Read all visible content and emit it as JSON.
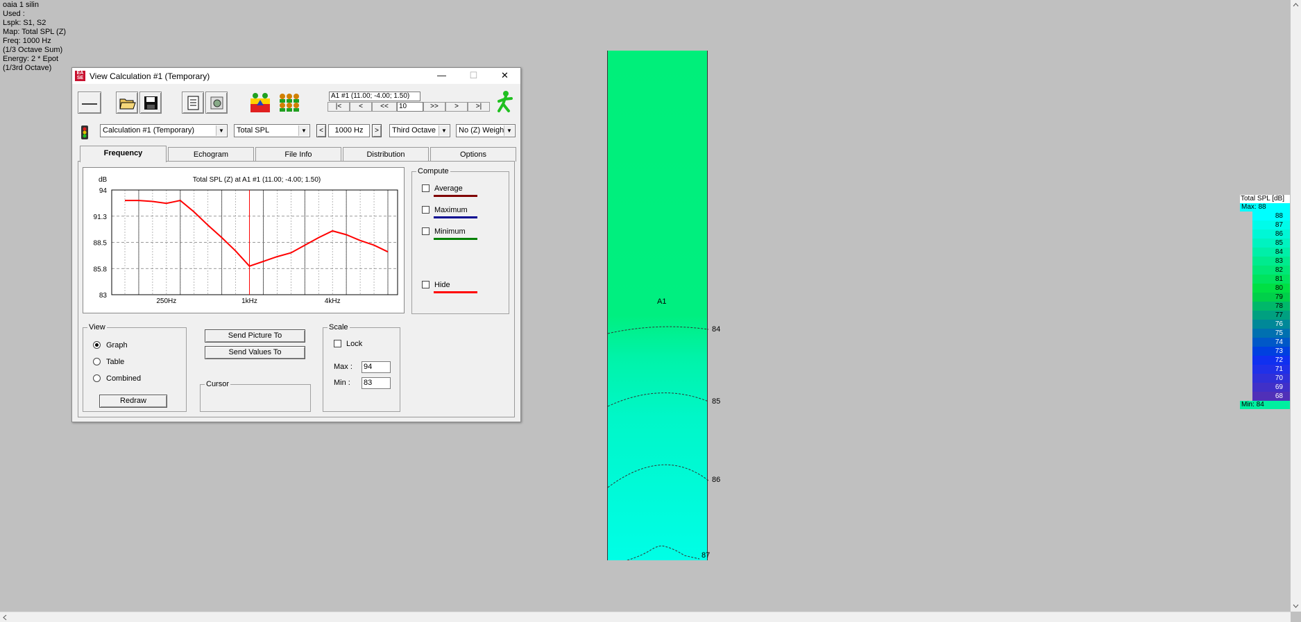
{
  "info_lines": [
    "oaia 1 silin",
    "Used :",
    "Lspk: S1, S2",
    "Map: Total SPL (Z)",
    "Freq: 1000 Hz",
    "(1/3 Octave Sum)",
    "Energy: 2 * Epot",
    "(1/3rd Octave)"
  ],
  "window": {
    "title": "View Calculation #1 (Temporary)",
    "minimize": "—",
    "maximize": "☐",
    "close": "✕"
  },
  "nav": {
    "position": "A1 #1  (11.00; -4.00; 1.50)",
    "first": "|<",
    "prev": "<",
    "prev_fast": "<<",
    "step": "10",
    "next_fast": ">>",
    "next": ">",
    "last": ">|"
  },
  "selectors": {
    "calculation": "Calculation #1 (Temporary)",
    "map": "Total SPL",
    "freq_prev": "<",
    "freq": "1000 Hz",
    "freq_next": ">",
    "band": "Third Octave",
    "weighting": "No (Z) Weigh"
  },
  "tabs": [
    "Frequency",
    "Echogram",
    "File Info",
    "Distribution",
    "Options"
  ],
  "compute": {
    "legend": "Compute",
    "average": "Average",
    "maximum": "Maximum",
    "minimum": "Minimum",
    "hide": "Hide"
  },
  "view": {
    "legend": "View",
    "graph": "Graph",
    "table": "Table",
    "combined": "Combined",
    "redraw": "Redraw"
  },
  "actions": {
    "send_picture": "Send Picture To",
    "send_values": "Send Values To"
  },
  "cursor": {
    "legend": "Cursor"
  },
  "scale": {
    "legend": "Scale",
    "lock": "Lock",
    "max_label": "Max :",
    "max": "94",
    "min_label": "Min :",
    "min": "83"
  },
  "chart_data": {
    "type": "line",
    "title": "Total SPL (Z) at A1 #1  (11.00; -4.00; 1.50)",
    "ylabel": "dB",
    "ylim": [
      83,
      94
    ],
    "yticks": [
      "94",
      "91.3",
      "88.5",
      "85.8",
      "83"
    ],
    "xtick_labels": [
      "250Hz",
      "1kHz",
      "4kHz"
    ],
    "grid": true,
    "cursor_freq": "1000 Hz",
    "series": [
      {
        "color": "#ff0000",
        "x": [
          "125",
          "160",
          "200",
          "250",
          "315",
          "400",
          "500",
          "630",
          "800",
          "1000",
          "1250",
          "1600",
          "2000",
          "2500",
          "3150",
          "4000",
          "5000",
          "6300",
          "8000",
          "10000"
        ],
        "values": [
          92.9,
          92.9,
          92.8,
          92.6,
          92.9,
          91.7,
          90.3,
          89.0,
          87.6,
          86.0,
          86.5,
          87.0,
          87.4,
          88.2,
          89.0,
          89.7,
          89.3,
          88.7,
          88.2,
          87.5
        ]
      }
    ]
  },
  "room": {
    "label": "A1",
    "contours": [
      "84",
      "85",
      "86",
      "87"
    ]
  },
  "legend": {
    "title": "Total SPL [dB]",
    "max_label": "Max:  88",
    "min_label": "Min:  84",
    "rows": [
      {
        "v": "88",
        "c": "#00ffff"
      },
      {
        "v": "87",
        "c": "#00fbea"
      },
      {
        "v": "86",
        "c": "#00f7d6"
      },
      {
        "v": "85",
        "c": "#00f3c0"
      },
      {
        "v": "84",
        "c": "#00efa8"
      },
      {
        "v": "83",
        "c": "#00eb8e"
      },
      {
        "v": "82",
        "c": "#00e777"
      },
      {
        "v": "81",
        "c": "#00e35e"
      },
      {
        "v": "80",
        "c": "#00df44"
      },
      {
        "v": "79",
        "c": "#00d04a"
      },
      {
        "v": "78",
        "c": "#00b86a"
      },
      {
        "v": "77",
        "c": "#00a080"
      },
      {
        "v": "76",
        "c": "#008898"
      },
      {
        "v": "75",
        "c": "#0070b0"
      },
      {
        "v": "74",
        "c": "#0058c8"
      },
      {
        "v": "73",
        "c": "#0040e0"
      },
      {
        "v": "72",
        "c": "#1030f0"
      },
      {
        "v": "71",
        "c": "#2030e8"
      },
      {
        "v": "70",
        "c": "#3030d8"
      },
      {
        "v": "69",
        "c": "#4030c8"
      },
      {
        "v": "68",
        "c": "#5030b8"
      }
    ]
  }
}
